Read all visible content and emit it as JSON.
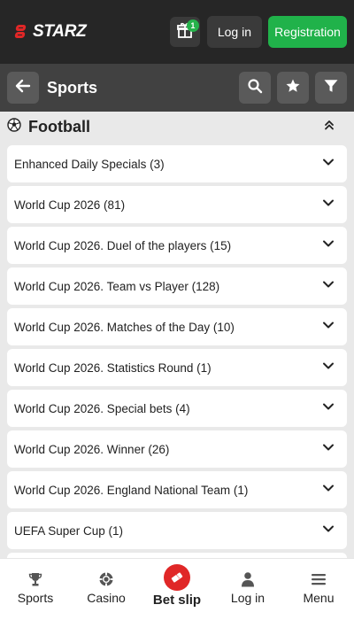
{
  "header": {
    "logo_text": "STARZ",
    "gift_badge": "1",
    "login_label": "Log in",
    "registration_label": "Registration"
  },
  "sports_bar": {
    "title": "Sports",
    "icons": [
      "back-arrow-icon",
      "search-icon",
      "star-icon",
      "filter-icon"
    ]
  },
  "section": {
    "title": "Football",
    "icon": "soccer-ball-icon"
  },
  "list": {
    "items": [
      {
        "label": "Enhanced Daily Specials (3)"
      },
      {
        "label": "World Cup 2026 (81)"
      },
      {
        "label": "World Cup 2026. Duel of the players (15)"
      },
      {
        "label": "World Cup 2026. Team vs Player (128)"
      },
      {
        "label": "World Cup 2026. Matches of the Day (10)"
      },
      {
        "label": "World Cup 2026. Statistics Round (1)"
      },
      {
        "label": "World Cup 2026. Special bets (4)"
      },
      {
        "label": "World Cup 2026. Winner (26)"
      },
      {
        "label": "World Cup 2026. England National Team (1)"
      },
      {
        "label": "UEFA Super Cup (1)"
      }
    ]
  },
  "bottom_nav": {
    "sports": "Sports",
    "casino": "Casino",
    "betslip": "Bet slip",
    "login": "Log in",
    "menu": "Menu"
  },
  "colors": {
    "brand_red": "#e02727",
    "registration_green": "#20b24a",
    "header_bg": "#262626",
    "sports_bar_bg": "#414141"
  }
}
